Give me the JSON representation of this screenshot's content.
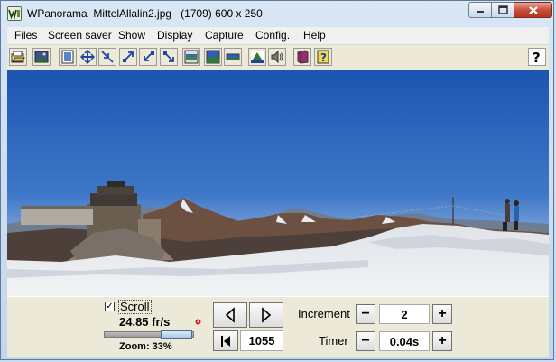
{
  "window": {
    "title": "WPanorama  MittelAllalin2.jpg   (1709) 600 x 250",
    "app_icon": "wpanorama-w-icon",
    "buttons": [
      "minimize-icon",
      "maximize-icon",
      "close-icon"
    ]
  },
  "menu": {
    "files": "Files",
    "screen_saver": "Screen saver",
    "show": "Show",
    "display": "Display",
    "capture": "Capture",
    "config": "Config.",
    "help": "Help"
  },
  "toolbar": {
    "icons": [
      "open-icon",
      "picture-icon",
      "page-icon",
      "resize-icon",
      "shrink-icon",
      "expand-up-icon",
      "shrink-down-icon",
      "expand-down-icon",
      "panorama-strip-icon",
      "panorama-blue-icon",
      "panorama-flat-icon",
      "landscape-icon",
      "speaker-icon",
      "book-icon",
      "help-book-icon",
      "help-question-icon"
    ],
    "help_label": "?"
  },
  "controls": {
    "scroll_checked": true,
    "check_mark": "✓",
    "scroll_label": "Scroll",
    "fps": "24.85 fr/s",
    "zoom_label": "Zoom: 33%",
    "zoom_fraction": 0.33,
    "position_value": "1055",
    "increment_label": "Increment",
    "increment_value": "2",
    "timer_label": "Timer",
    "timer_value": "0.04s",
    "minus": "−",
    "plus": "+"
  },
  "colors": {
    "sky_top": "#1e58b2",
    "sky_horizon": "#a7c2e4",
    "snow": "#e9eaec",
    "title_bg": "#c9dbee"
  }
}
